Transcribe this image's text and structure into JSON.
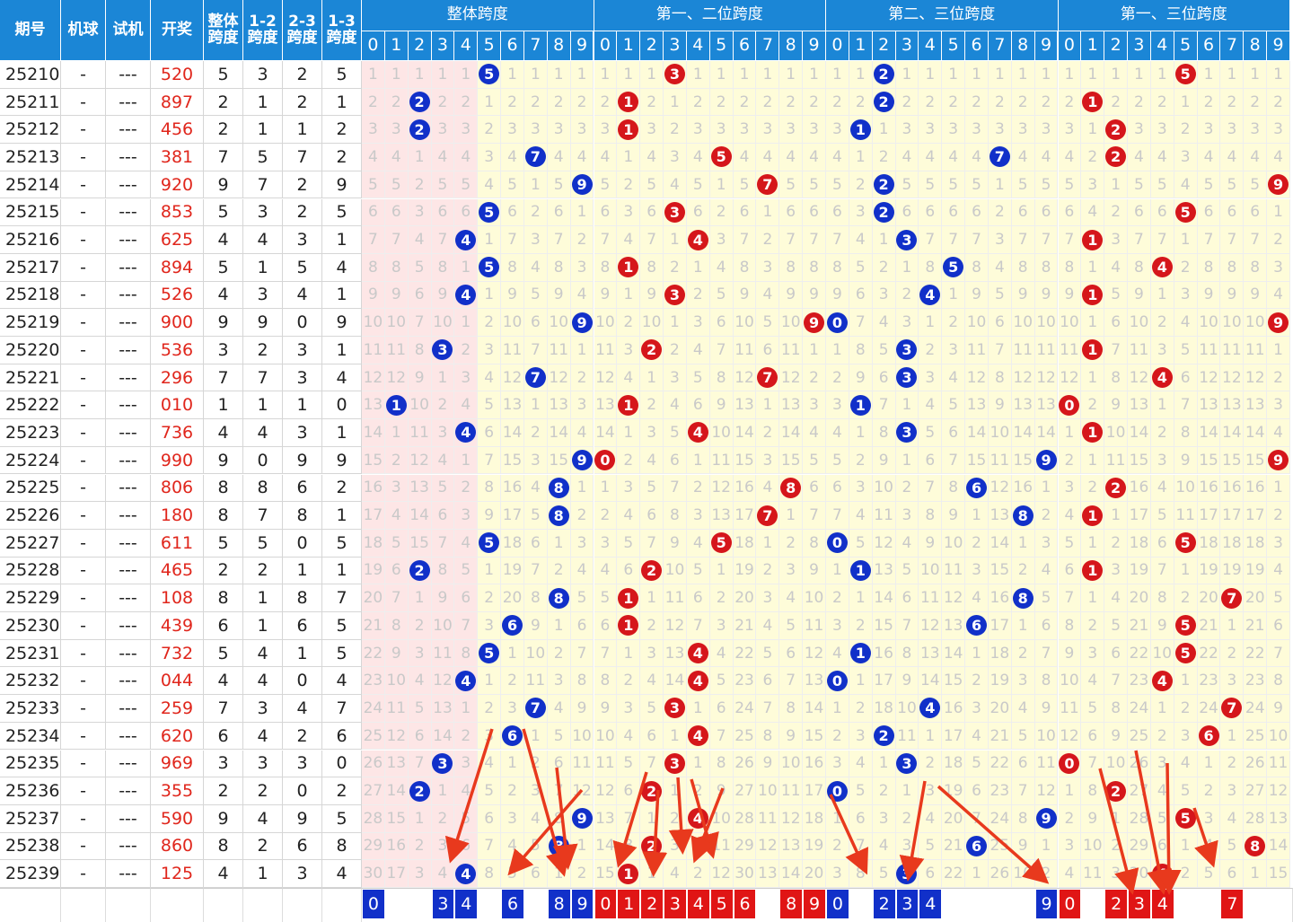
{
  "headers": {
    "fixed": [
      "期号",
      "机球",
      "试机",
      "开奖",
      "整体\n跨度",
      "1-2\n跨度",
      "2-3\n跨度",
      "1-3\n跨度"
    ],
    "groups": [
      "整体跨度",
      "第一、二位跨度",
      "第二、三位跨度",
      "第一、三位跨度"
    ],
    "digits": [
      "0",
      "1",
      "2",
      "3",
      "4",
      "5",
      "6",
      "7",
      "8",
      "9"
    ]
  },
  "colors": {
    "header_bg": "#1b86d6",
    "ball_blue": "#1130c9",
    "ball_red": "#d5161b",
    "zone_pink": "#fde6e6",
    "zone_cream": "#fefcd9",
    "lottery_text": "#e0261c",
    "arrow": "#e8391d"
  },
  "chart_data": {
    "type": "table",
    "rows": [
      {
        "issue": "25210",
        "machine": "-",
        "trial": "---",
        "lottery": "520",
        "span": 5,
        "s12": 3,
        "s23": 2,
        "s13": 5
      },
      {
        "issue": "25211",
        "machine": "-",
        "trial": "---",
        "lottery": "897",
        "span": 2,
        "s12": 1,
        "s23": 2,
        "s13": 1
      },
      {
        "issue": "25212",
        "machine": "-",
        "trial": "---",
        "lottery": "456",
        "span": 2,
        "s12": 1,
        "s23": 1,
        "s13": 2
      },
      {
        "issue": "25213",
        "machine": "-",
        "trial": "---",
        "lottery": "381",
        "span": 7,
        "s12": 5,
        "s23": 7,
        "s13": 2
      },
      {
        "issue": "25214",
        "machine": "-",
        "trial": "---",
        "lottery": "920",
        "span": 9,
        "s12": 7,
        "s23": 2,
        "s13": 9
      },
      {
        "issue": "25215",
        "machine": "-",
        "trial": "---",
        "lottery": "853",
        "span": 5,
        "s12": 3,
        "s23": 2,
        "s13": 5
      },
      {
        "issue": "25216",
        "machine": "-",
        "trial": "---",
        "lottery": "625",
        "span": 4,
        "s12": 4,
        "s23": 3,
        "s13": 1
      },
      {
        "issue": "25217",
        "machine": "-",
        "trial": "---",
        "lottery": "894",
        "span": 5,
        "s12": 1,
        "s23": 5,
        "s13": 4
      },
      {
        "issue": "25218",
        "machine": "-",
        "trial": "---",
        "lottery": "526",
        "span": 4,
        "s12": 3,
        "s23": 4,
        "s13": 1
      },
      {
        "issue": "25219",
        "machine": "-",
        "trial": "---",
        "lottery": "900",
        "span": 9,
        "s12": 9,
        "s23": 0,
        "s13": 9
      },
      {
        "issue": "25220",
        "machine": "-",
        "trial": "---",
        "lottery": "536",
        "span": 3,
        "s12": 2,
        "s23": 3,
        "s13": 1
      },
      {
        "issue": "25221",
        "machine": "-",
        "trial": "---",
        "lottery": "296",
        "span": 7,
        "s12": 7,
        "s23": 3,
        "s13": 4
      },
      {
        "issue": "25222",
        "machine": "-",
        "trial": "---",
        "lottery": "010",
        "span": 1,
        "s12": 1,
        "s23": 1,
        "s13": 0
      },
      {
        "issue": "25223",
        "machine": "-",
        "trial": "---",
        "lottery": "736",
        "span": 4,
        "s12": 4,
        "s23": 3,
        "s13": 1
      },
      {
        "issue": "25224",
        "machine": "-",
        "trial": "---",
        "lottery": "990",
        "span": 9,
        "s12": 0,
        "s23": 9,
        "s13": 9
      },
      {
        "issue": "25225",
        "machine": "-",
        "trial": "---",
        "lottery": "806",
        "span": 8,
        "s12": 8,
        "s23": 6,
        "s13": 2
      },
      {
        "issue": "25226",
        "machine": "-",
        "trial": "---",
        "lottery": "180",
        "span": 8,
        "s12": 7,
        "s23": 8,
        "s13": 1
      },
      {
        "issue": "25227",
        "machine": "-",
        "trial": "---",
        "lottery": "611",
        "span": 5,
        "s12": 5,
        "s23": 0,
        "s13": 5
      },
      {
        "issue": "25228",
        "machine": "-",
        "trial": "---",
        "lottery": "465",
        "span": 2,
        "s12": 2,
        "s23": 1,
        "s13": 1
      },
      {
        "issue": "25229",
        "machine": "-",
        "trial": "---",
        "lottery": "108",
        "span": 8,
        "s12": 1,
        "s23": 8,
        "s13": 7
      },
      {
        "issue": "25230",
        "machine": "-",
        "trial": "---",
        "lottery": "439",
        "span": 6,
        "s12": 1,
        "s23": 6,
        "s13": 5
      },
      {
        "issue": "25231",
        "machine": "-",
        "trial": "---",
        "lottery": "732",
        "span": 5,
        "s12": 4,
        "s23": 1,
        "s13": 5
      },
      {
        "issue": "25232",
        "machine": "-",
        "trial": "---",
        "lottery": "044",
        "span": 4,
        "s12": 4,
        "s23": 0,
        "s13": 4
      },
      {
        "issue": "25233",
        "machine": "-",
        "trial": "---",
        "lottery": "259",
        "span": 7,
        "s12": 3,
        "s23": 4,
        "s13": 7
      },
      {
        "issue": "25234",
        "machine": "-",
        "trial": "---",
        "lottery": "620",
        "span": 6,
        "s12": 4,
        "s23": 2,
        "s13": 6
      },
      {
        "issue": "25235",
        "machine": "-",
        "trial": "---",
        "lottery": "969",
        "span": 3,
        "s12": 3,
        "s23": 3,
        "s13": 0
      },
      {
        "issue": "25236",
        "machine": "-",
        "trial": "---",
        "lottery": "355",
        "span": 2,
        "s12": 2,
        "s23": 0,
        "s13": 2
      },
      {
        "issue": "25237",
        "machine": "-",
        "trial": "---",
        "lottery": "590",
        "span": 9,
        "s12": 4,
        "s23": 9,
        "s13": 5
      },
      {
        "issue": "25238",
        "machine": "-",
        "trial": "---",
        "lottery": "860",
        "span": 8,
        "s12": 2,
        "s23": 6,
        "s13": 8
      },
      {
        "issue": "25239",
        "machine": "-",
        "trial": "---",
        "lottery": "125",
        "span": 4,
        "s12": 1,
        "s23": 3,
        "s13": 4
      }
    ],
    "footer_predictions": {
      "overall": [
        0,
        3,
        4,
        6,
        8,
        9
      ],
      "pos12": [
        0,
        1,
        2,
        3,
        4,
        5,
        6,
        8,
        9
      ],
      "pos23": [
        0,
        2,
        3,
        4,
        9
      ],
      "pos13": [
        0,
        2,
        3,
        4,
        7
      ]
    },
    "annotation": "red hand-drawn arrows point from the last rows to predicted digits in the footer"
  }
}
